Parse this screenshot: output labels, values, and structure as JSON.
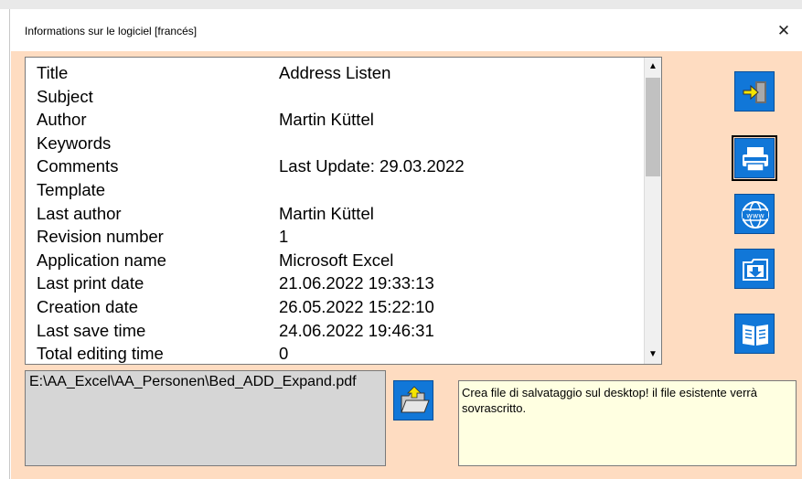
{
  "window": {
    "title": "Informations sur le logiciel  [francés]",
    "close_glyph": "✕"
  },
  "properties": [
    {
      "key": "Title",
      "value": "Address Listen"
    },
    {
      "key": "Subject",
      "value": ""
    },
    {
      "key": "Author",
      "value": "Martin Küttel"
    },
    {
      "key": "Keywords",
      "value": ""
    },
    {
      "key": "Comments",
      "value": "Last Update: 29.03.2022"
    },
    {
      "key": "Template",
      "value": ""
    },
    {
      "key": "Last author",
      "value": "Martin Küttel"
    },
    {
      "key": "Revision number",
      "value": "1"
    },
    {
      "key": "Application name",
      "value": "Microsoft Excel"
    },
    {
      "key": "Last print date",
      "value": "21.06.2022 19:33:13"
    },
    {
      "key": "Creation date",
      "value": "26.05.2022 15:22:10"
    },
    {
      "key": "Last save time",
      "value": "24.06.2022 19:46:31"
    },
    {
      "key": "Total editing time",
      "value": "0"
    }
  ],
  "scrollbar": {
    "up": "▲",
    "down": "▼"
  },
  "side_buttons": [
    {
      "name": "exit-button",
      "icon": "exit-door-icon",
      "selected": false
    },
    {
      "name": "print-button",
      "icon": "printer-icon",
      "selected": true
    },
    {
      "name": "web-button",
      "icon": "globe-www-icon",
      "selected": false
    },
    {
      "name": "export-button",
      "icon": "folder-download-icon",
      "selected": false
    },
    {
      "name": "manual-button",
      "icon": "book-icon",
      "selected": false
    }
  ],
  "path": {
    "value": "E:\\AA_Excel\\AA_Personen\\Bed_ADD_Expand.pdf"
  },
  "folder_button": {
    "icon": "open-folder-icon"
  },
  "note": {
    "text": "Crea file di salvataggio sul desktop! il file esistente verrà sovrascritto."
  },
  "colors": {
    "client_bg": "#fedcc1",
    "button_blue": "#1177d8",
    "note_bg": "#ffffe1",
    "path_bg": "#d6d6d6"
  }
}
